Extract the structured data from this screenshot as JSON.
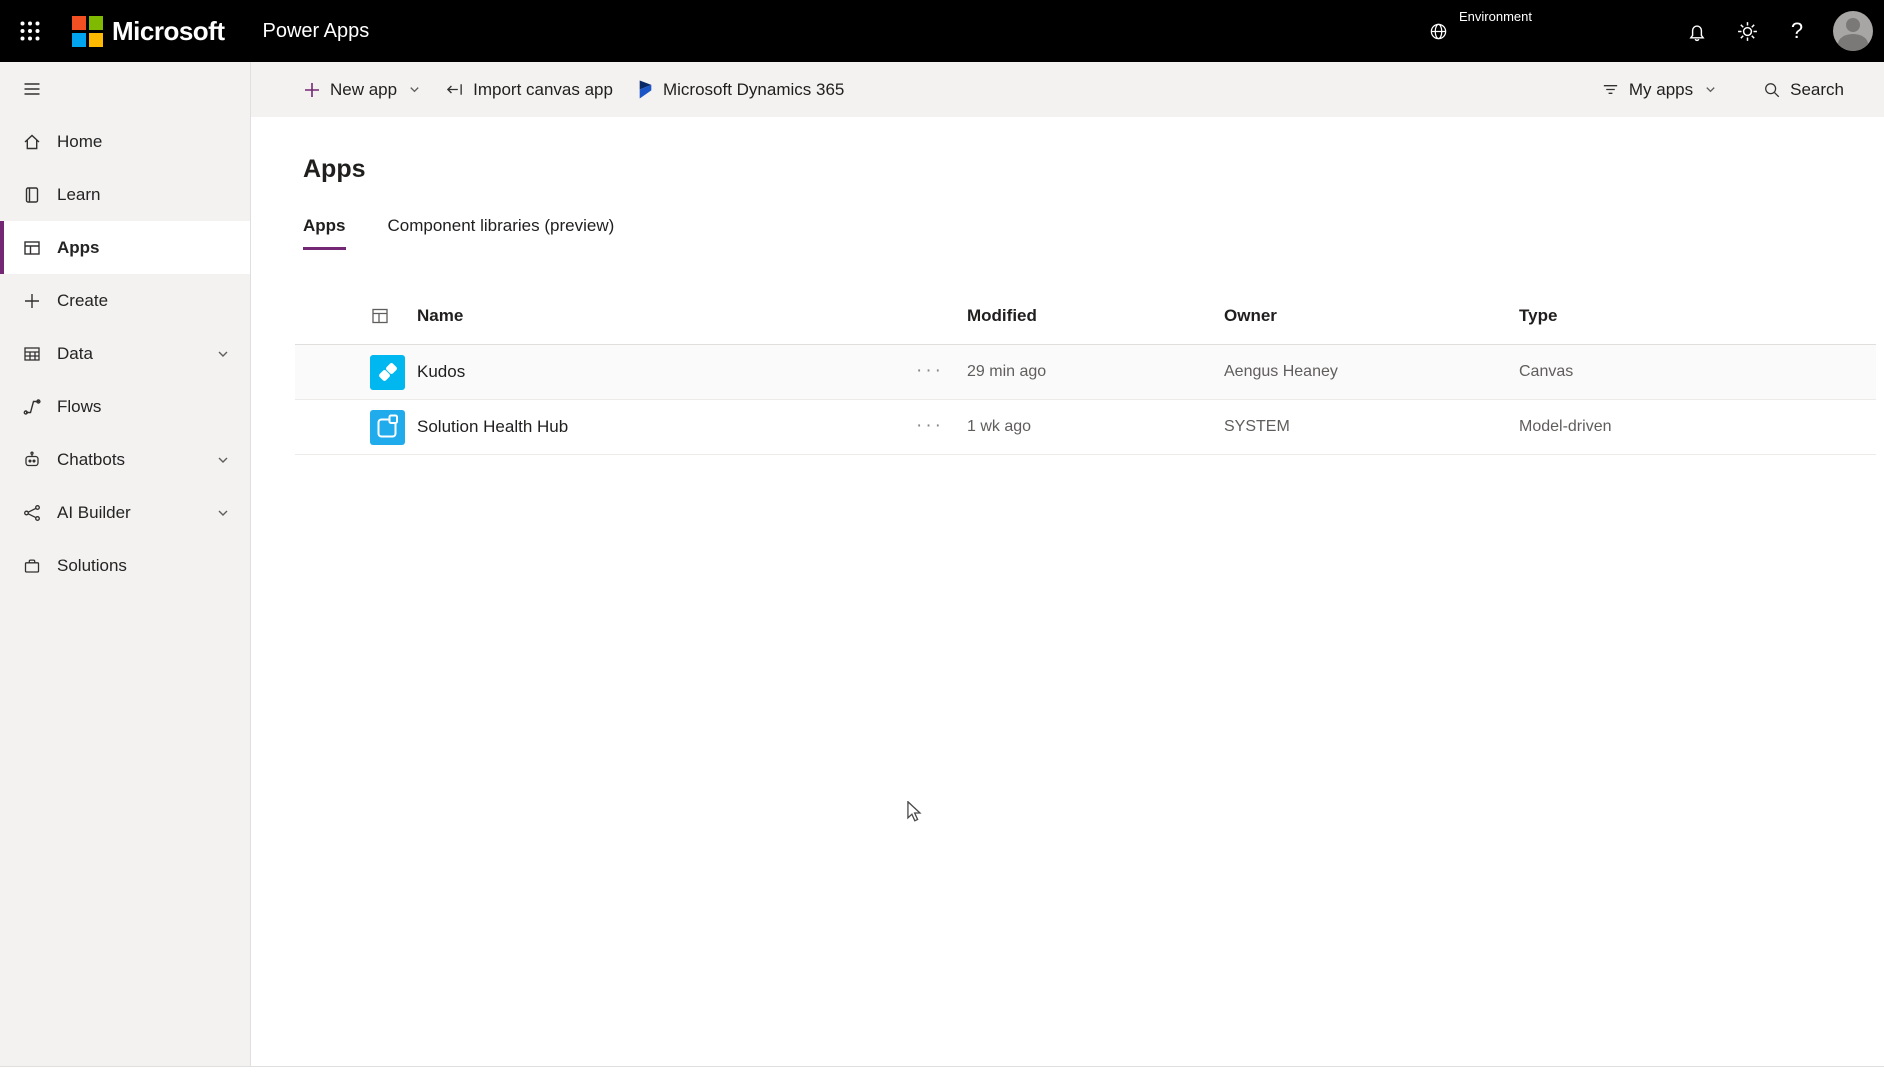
{
  "colors": {
    "accent": "#742774",
    "topbar_bg": "#000000",
    "sidebar_bg": "#f3f2f1",
    "ms_red": "#f25022",
    "ms_green": "#7fba00",
    "ms_blue": "#00a4ef",
    "ms_yellow": "#ffb900",
    "app_icon_blue_1": "#00b7f0",
    "app_icon_blue_2": "#1fabec"
  },
  "header": {
    "brand": "Microsoft",
    "product": "Power Apps",
    "environment_label": "Environment"
  },
  "command_bar": {
    "new_app_label": "New app",
    "import_label": "Import canvas app",
    "dynamics_label": "Microsoft Dynamics 365",
    "filter_label": "My apps",
    "search_label": "Search"
  },
  "sidebar": {
    "items": [
      {
        "label": "Home",
        "selected": false,
        "expandable": false
      },
      {
        "label": "Learn",
        "selected": false,
        "expandable": false
      },
      {
        "label": "Apps",
        "selected": true,
        "expandable": false
      },
      {
        "label": "Create",
        "selected": false,
        "expandable": false
      },
      {
        "label": "Data",
        "selected": false,
        "expandable": true
      },
      {
        "label": "Flows",
        "selected": false,
        "expandable": false
      },
      {
        "label": "Chatbots",
        "selected": false,
        "expandable": true
      },
      {
        "label": "AI Builder",
        "selected": false,
        "expandable": true
      },
      {
        "label": "Solutions",
        "selected": false,
        "expandable": false
      }
    ]
  },
  "main": {
    "title": "Apps",
    "tabs": [
      {
        "label": "Apps",
        "active": true
      },
      {
        "label": "Component libraries (preview)",
        "active": false
      }
    ],
    "table": {
      "columns": {
        "name": "Name",
        "modified": "Modified",
        "owner": "Owner",
        "type": "Type"
      },
      "rows": [
        {
          "name": "Kudos",
          "modified": "29 min ago",
          "owner": "Aengus Heaney",
          "type": "Canvas"
        },
        {
          "name": "Solution Health Hub",
          "modified": "1 wk ago",
          "owner": "SYSTEM",
          "type": "Model-driven"
        }
      ]
    }
  },
  "icons": {
    "more_glyph": "···",
    "help_glyph": "?"
  }
}
